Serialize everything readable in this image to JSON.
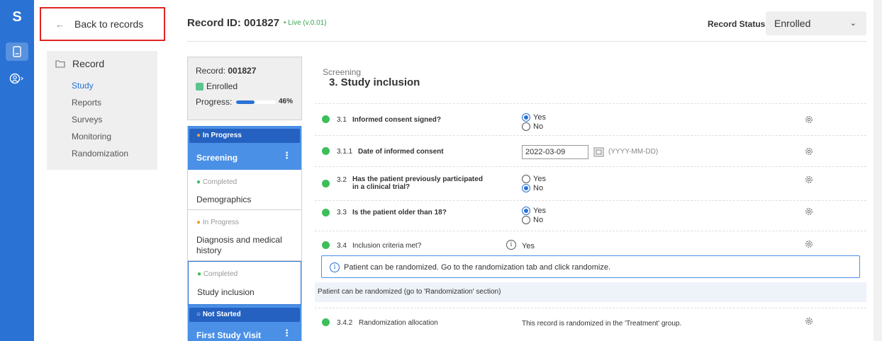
{
  "rail": {
    "logo": "S",
    "icons": [
      "records-icon",
      "user-icon"
    ]
  },
  "nav": {
    "back_label": "Back to records",
    "section_label": "Record",
    "items": [
      {
        "label": "Study",
        "selected": true
      },
      {
        "label": "Reports",
        "selected": false
      },
      {
        "label": "Surveys",
        "selected": false
      },
      {
        "label": "Monitoring",
        "selected": false
      },
      {
        "label": "Randomization",
        "selected": false
      }
    ]
  },
  "header": {
    "record_title": "Record ID: 001827",
    "live": "• Live (v.0.01)",
    "status_label": "Record Status:",
    "status_value": "Enrolled"
  },
  "summary": {
    "record_prefix": "Record: ",
    "record_id": "001827",
    "status": "Enrolled",
    "progress_label": "Progress:",
    "progress_pct": "46%",
    "progress_value": 0.46
  },
  "steps": [
    {
      "tag": "In Progress",
      "title": "Screening",
      "style": "blue"
    },
    {
      "tag": "Completed",
      "title": "Demographics",
      "style": "white"
    },
    {
      "tag": "In Progress",
      "title": "Diagnosis and medical history",
      "style": "white"
    },
    {
      "tag": "Completed",
      "title": "Study inclusion",
      "style": "white-selected"
    },
    {
      "tag": "Not Started",
      "title": "First Study Visit",
      "style": "blue"
    }
  ],
  "tag_colors": {
    "Completed": "#3cbf5a",
    "In Progress": "#f0a030",
    "Not Started": "#ffffff"
  },
  "form": {
    "sub": "Screening",
    "title": "3. Study inclusion",
    "q1": {
      "num": "3.1",
      "text": "Informed consent signed?",
      "opt1": "Yes",
      "opt2": "No",
      "selected": "Yes"
    },
    "q2": {
      "num": "3.1.1",
      "text": "Date of informed consent",
      "value": "2022-03-09",
      "format": "(YYYY-MM-DD)"
    },
    "q3": {
      "num": "3.2",
      "text_line1": "Has the patient previously participated",
      "text_line2": "in a clinical trial?",
      "opt1": "Yes",
      "opt2": "No",
      "selected": "No"
    },
    "q4": {
      "num": "3.3",
      "text": "Is the patient older than 18?",
      "opt1": "Yes",
      "opt2": "No",
      "selected": "Yes"
    },
    "q5": {
      "num": "3.4",
      "text": "Inclusion criteria met?",
      "value": "Yes"
    },
    "info": "Patient can be randomized. Go to the randomization tab and click randomize.",
    "band": "Patient can be randomized (go to 'Randomization' section)",
    "q6": {
      "num": "3.4.2",
      "text": "Randomization allocation",
      "value": "This record is randomized in the 'Treatment' group."
    }
  }
}
